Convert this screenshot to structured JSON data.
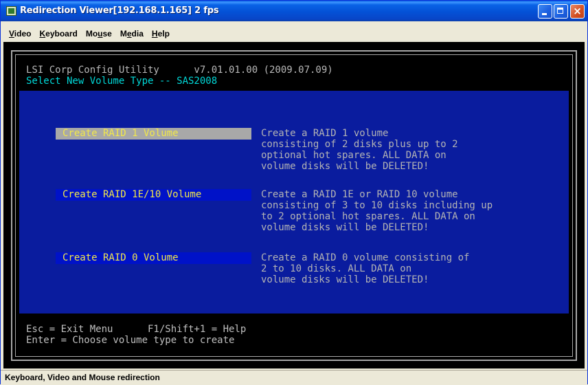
{
  "window": {
    "title": "Redirection Viewer[192.168.1.165]  2 fps",
    "icon": "app-icon",
    "controls": {
      "minimize": "minimize-icon",
      "maximize": "maximize-icon",
      "close": "×"
    }
  },
  "menu": [
    {
      "label": "Video",
      "underline": "V"
    },
    {
      "label": "Keyboard",
      "underline": "K"
    },
    {
      "label": "Mouse",
      "underline": "u"
    },
    {
      "label": "Media",
      "underline": "e"
    },
    {
      "label": "Help",
      "underline": "H"
    }
  ],
  "console": {
    "header_line1": "LSI Corp Config Utility      v7.01.01.00 (2009.07.09)",
    "header_line2": "Select New Volume Type -- SAS2008",
    "options": [
      {
        "label": "Create RAID 1 Volume",
        "selected": true,
        "description": "Create a RAID 1 volume\nconsisting of 2 disks plus up to 2\noptional hot spares. ALL DATA on\nvolume disks will be DELETED!"
      },
      {
        "label": "Create RAID 1E/10 Volume",
        "selected": false,
        "description": "Create a RAID 1E or RAID 10 volume\nconsisting of 3 to 10 disks including up\nto 2 optional hot spares. ALL DATA on\nvolume disks will be DELETED!"
      },
      {
        "label": "Create RAID 0 Volume",
        "selected": false,
        "description": "Create a RAID 0 volume consisting of\n2 to 10 disks. ALL DATA on\nvolume disks will be DELETED!"
      }
    ],
    "footer_line1": "Esc = Exit Menu      F1/Shift+1 = Help",
    "footer_line2": "Enter = Choose volume type to create",
    "colors": {
      "background": "#0a1c9e",
      "highlight": "#a8a8a8",
      "option_text": "#f2e84a",
      "header_cyan": "#00d8d8"
    }
  },
  "status_bar": {
    "text": "Keyboard, Video and Mouse redirection"
  }
}
